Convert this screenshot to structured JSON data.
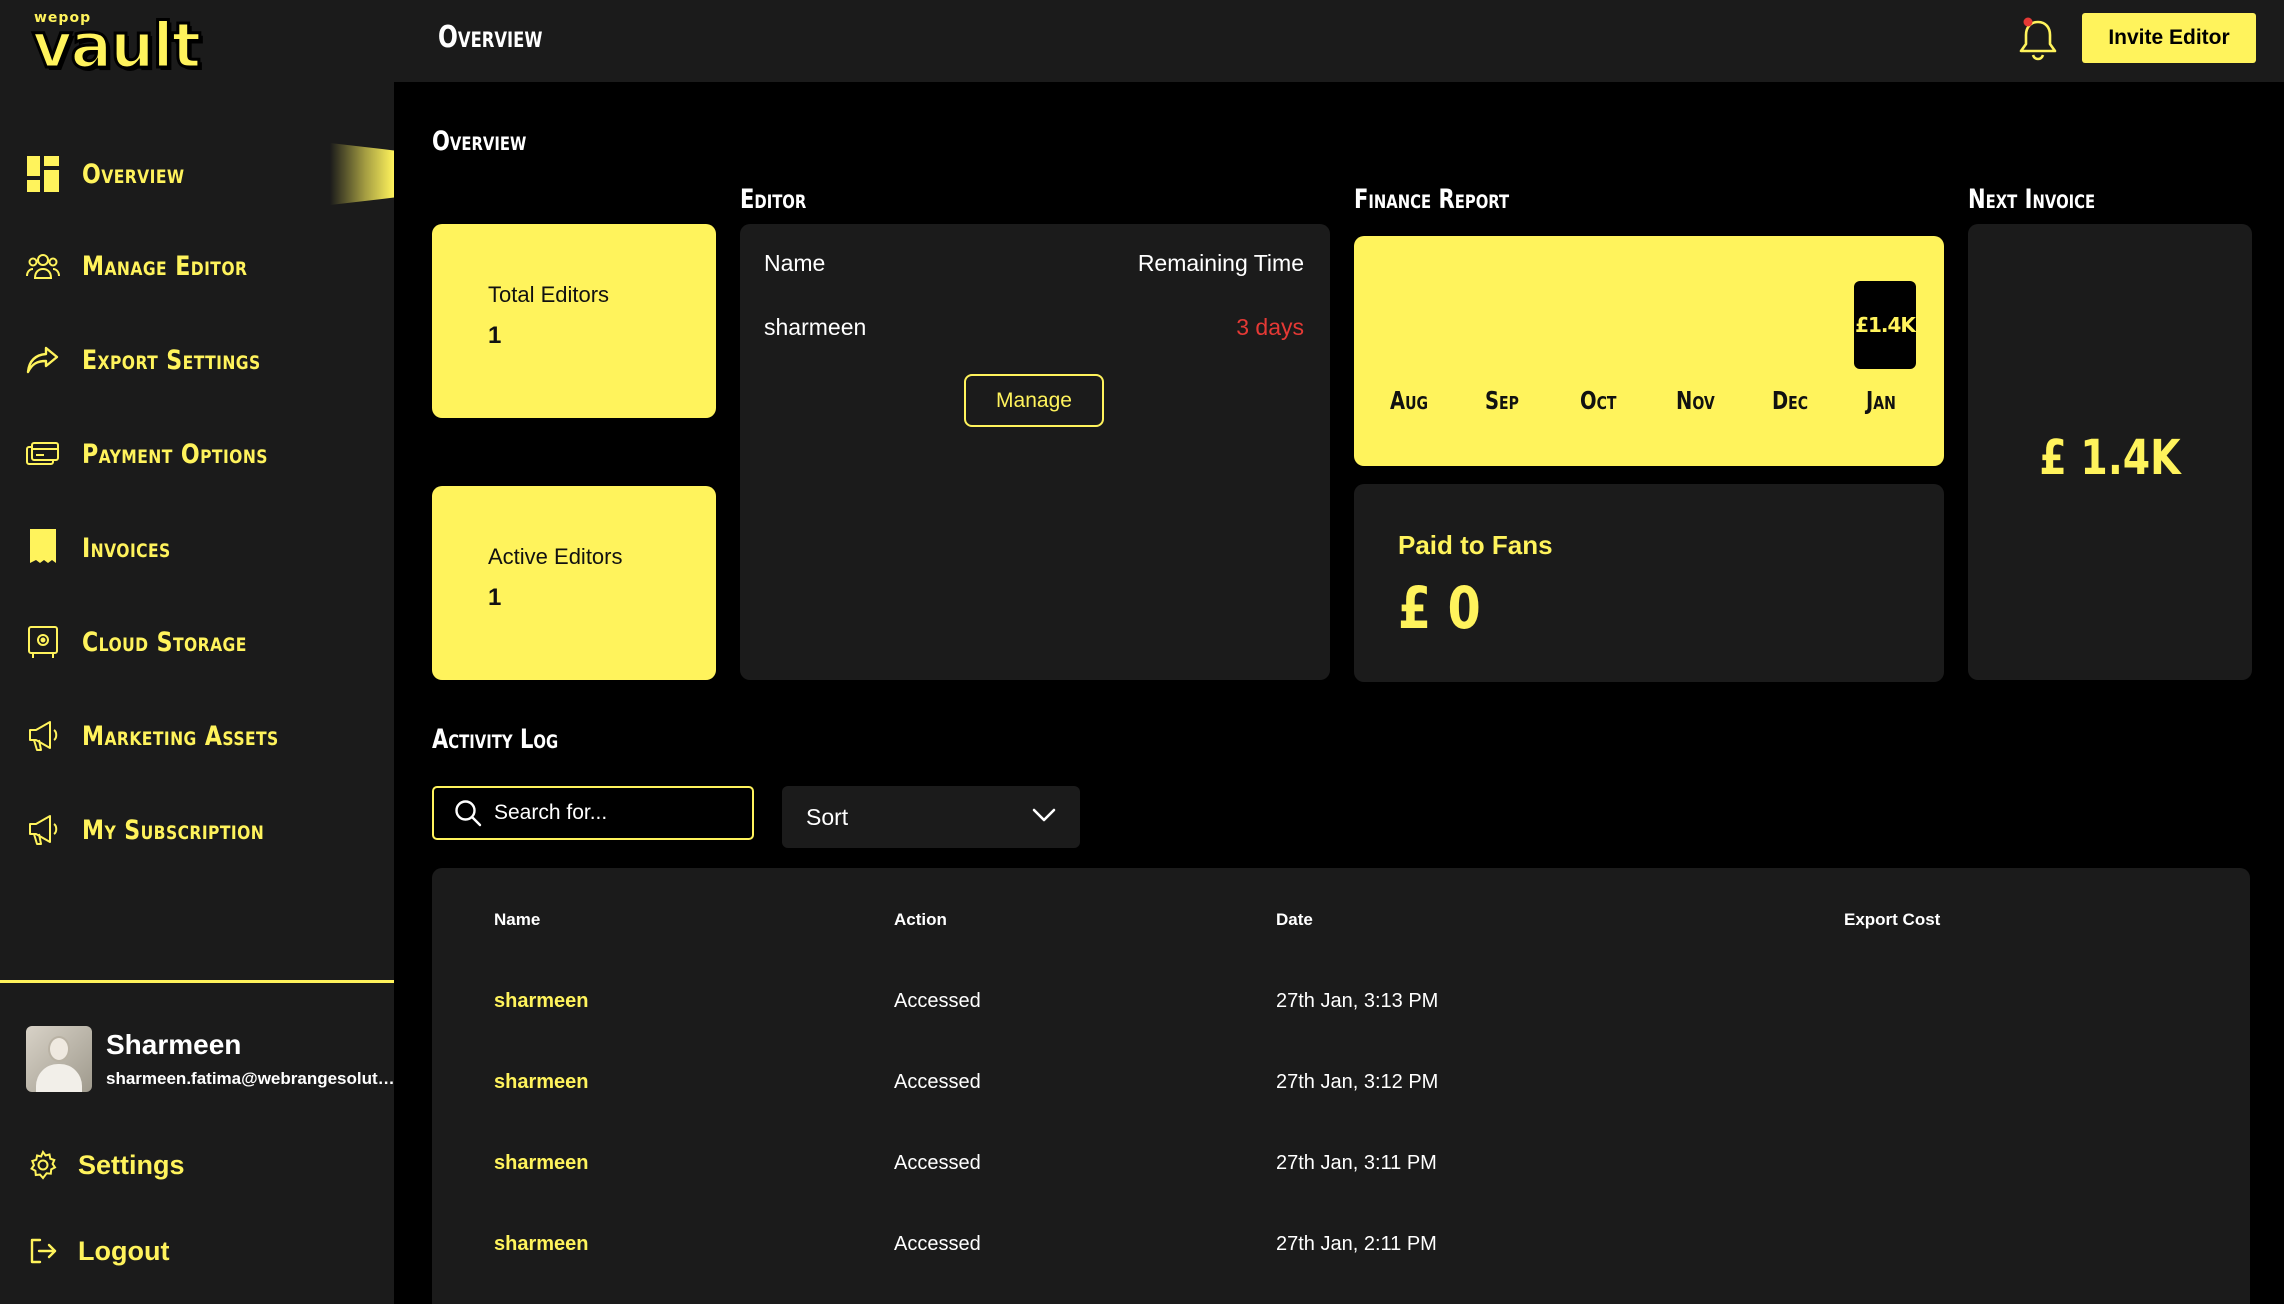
{
  "brand": {
    "pre": "wepop",
    "name": "vault"
  },
  "sidebar": {
    "items": [
      {
        "label": "Overview",
        "icon": "overview-grid-icon"
      },
      {
        "label": "Manage Editor",
        "icon": "users-icon"
      },
      {
        "label": "Export Settings",
        "icon": "share-arrow-icon"
      },
      {
        "label": "Payment Options",
        "icon": "credit-card-icon"
      },
      {
        "label": "Invoices",
        "icon": "receipt-icon"
      },
      {
        "label": "Cloud Storage",
        "icon": "vault-safe-icon"
      },
      {
        "label": "Marketing Assets",
        "icon": "megaphone-icon"
      },
      {
        "label": "My Subscription",
        "icon": "megaphone-icon"
      }
    ],
    "active": "Overview"
  },
  "profile": {
    "name": "Sharmeen",
    "email": "sharmeen.fatima@webrangesolutions.com"
  },
  "bottom_links": {
    "settings": "Settings",
    "logout": "Logout"
  },
  "header": {
    "title": "Overview",
    "invite_button": "Invite Editor"
  },
  "overview": {
    "section_title": "Overview",
    "total_editors": {
      "label": "Total Editors",
      "value": "1"
    },
    "active_editors": {
      "label": "Active Editors",
      "value": "1"
    }
  },
  "editor": {
    "section_title": "Editor",
    "col_name": "Name",
    "col_remaining": "Remaining Time",
    "rows": [
      {
        "name": "sharmeen",
        "remaining": "3 days"
      }
    ],
    "manage_button": "Manage"
  },
  "finance": {
    "section_title": "Finance Report",
    "months": [
      "Aug",
      "Sep",
      "Oct",
      "Nov",
      "Dec",
      "Jan"
    ],
    "current_label": "£1.4K",
    "paid_to_fans_label": "Paid to Fans",
    "paid_to_fans_value": "£ 0"
  },
  "next_invoice": {
    "section_title": "Next Invoice",
    "value": "£ 1.4K"
  },
  "activity": {
    "section_title": "Activity Log",
    "search_placeholder": "Search for...",
    "sort_label": "Sort",
    "columns": [
      "Name",
      "Action",
      "Date",
      "Export Cost"
    ],
    "rows": [
      {
        "name": "sharmeen",
        "action": "Accessed",
        "date": "27th Jan, 3:13 PM",
        "cost": ""
      },
      {
        "name": "sharmeen",
        "action": "Accessed",
        "date": "27th Jan, 3:12 PM",
        "cost": ""
      },
      {
        "name": "sharmeen",
        "action": "Accessed",
        "date": "27th Jan, 3:11 PM",
        "cost": ""
      },
      {
        "name": "sharmeen",
        "action": "Accessed",
        "date": "27th Jan, 2:11 PM",
        "cost": ""
      }
    ]
  },
  "colors": {
    "accent": "#fff35c",
    "panel": "#1b1b1b",
    "background": "#000000",
    "alert_text": "#e53935"
  }
}
